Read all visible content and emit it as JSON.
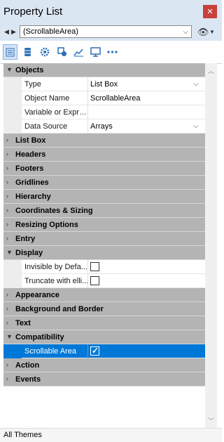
{
  "window": {
    "title": "Property List",
    "close_glyph": "×"
  },
  "object_selector": {
    "value": "(ScrollableArea)"
  },
  "toolbar": {
    "buttons": [
      {
        "icon": "property-list-icon",
        "active": true
      },
      {
        "icon": "database-icon"
      },
      {
        "icon": "gear-icon"
      },
      {
        "icon": "shapes-icon"
      },
      {
        "icon": "chart-icon"
      },
      {
        "icon": "monitor-icon"
      },
      {
        "icon": "more-icon"
      }
    ]
  },
  "sections": {
    "objects": "Objects",
    "list_box": "List Box",
    "headers": "Headers",
    "footers": "Footers",
    "gridlines": "Gridlines",
    "hierarchy": "Hierarchy",
    "coordinates": "Coordinates & Sizing",
    "resizing": "Resizing Options",
    "entry": "Entry",
    "display": "Display",
    "appearance": "Appearance",
    "background": "Background and Border",
    "text": "Text",
    "compatibility": "Compatibility",
    "action": "Action",
    "events": "Events"
  },
  "props": {
    "type": {
      "label": "Type",
      "value": "List Box"
    },
    "object_name": {
      "label": "Object Name",
      "value": "ScrollableArea"
    },
    "variable": {
      "label": "Variable or Expre...",
      "value": ""
    },
    "data_source": {
      "label": "Data Source",
      "value": "Arrays"
    },
    "invisible": {
      "label": "Invisible by Defa...",
      "checked": false
    },
    "truncate": {
      "label": "Truncate with elli...",
      "checked": false
    },
    "scrollable": {
      "label": "Scrollable Area",
      "checked": true
    }
  },
  "status_bar": {
    "text": "All Themes"
  },
  "colors": {
    "selection": "#0078d7",
    "section_header": "#b4b4b4",
    "titlebar": "#dbe6f3"
  }
}
